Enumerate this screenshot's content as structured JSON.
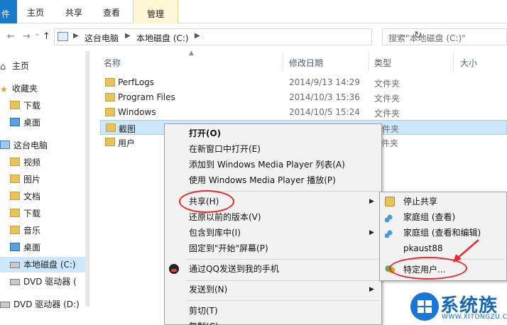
{
  "ribbon": {
    "tabs": [
      "件",
      "主页",
      "共享",
      "查看",
      "管理"
    ],
    "context_color": "#f3d24c"
  },
  "nav": {
    "back": "←",
    "forward": "→",
    "history": "⌄",
    "up": "↑",
    "breadcrumb": [
      "这台电脑",
      "本地磁盘 (C:)"
    ],
    "refresh": "↻",
    "search_placeholder": "搜索\"本地磁盘 (C:)\""
  },
  "sidebar": {
    "items": [
      {
        "label": "主页",
        "icon": "home-icon"
      },
      {
        "label": "收藏夹",
        "icon": "star-icon"
      },
      {
        "label": "下载",
        "icon": "download-folder-icon"
      },
      {
        "label": "桌面",
        "icon": "desktop-icon"
      },
      {
        "label": "这台电脑",
        "icon": "computer-icon"
      },
      {
        "label": "视频",
        "icon": "videos-folder-icon"
      },
      {
        "label": "图片",
        "icon": "pictures-folder-icon"
      },
      {
        "label": "文档",
        "icon": "documents-folder-icon"
      },
      {
        "label": "下载",
        "icon": "download-folder-icon"
      },
      {
        "label": "音乐",
        "icon": "music-folder-icon"
      },
      {
        "label": "桌面",
        "icon": "desktop-icon"
      },
      {
        "label": "本地磁盘 (C:)",
        "icon": "drive-icon"
      },
      {
        "label": "DVD 驱动器 (",
        "icon": "dvd-icon"
      },
      {
        "label": "DVD 驱动器 (D:)",
        "icon": "dvd-icon"
      }
    ]
  },
  "columns": {
    "name": "名称",
    "date": "修改日期",
    "type": "类型",
    "size": "大小"
  },
  "files": [
    {
      "name": "PerfLogs",
      "date": "2014/9/13 14:29",
      "type": "文件夹"
    },
    {
      "name": "Program Files",
      "date": "2014/10/3 15:36",
      "type": "文件夹"
    },
    {
      "name": "Windows",
      "date": "2014/10/5 15:24",
      "type": "文件夹"
    },
    {
      "name": "截图",
      "date": "",
      "type": "件夹"
    },
    {
      "name": "用户",
      "date": "",
      "type": "件夹"
    }
  ],
  "context_menu": {
    "items": [
      {
        "label": "打开(O)",
        "bold": true
      },
      {
        "label": "在新窗口中打开(E)"
      },
      {
        "label": "添加到 Windows Media Player 列表(A)"
      },
      {
        "label": "使用 Windows Media Player 播放(P)"
      },
      {
        "label": "共享(H)",
        "submenu": true
      },
      {
        "label": "还原以前的版本(V)"
      },
      {
        "label": "包含到库中(I)",
        "submenu": true
      },
      {
        "label": "固定到\"开始\"屏幕(P)"
      },
      {
        "label": "通过QQ发送到我的手机"
      },
      {
        "label": "发送到(N)",
        "submenu": true
      },
      {
        "label": "剪切(T)"
      },
      {
        "label": "复制(C)"
      }
    ]
  },
  "share_submenu": {
    "items": [
      {
        "label": "停止共享",
        "icon": "lock-icon"
      },
      {
        "label": "家庭组 (查看)",
        "icon": "homegroup-icon"
      },
      {
        "label": "家庭组 (查看和编辑)",
        "icon": "homegroup-icon"
      },
      {
        "label": "pkaust88",
        "icon": ""
      },
      {
        "label": "特定用户...",
        "icon": "people-icon"
      }
    ]
  },
  "watermark": {
    "brand": "系统族",
    "url": "WWW.XITONGZU.COM"
  },
  "annotation_color": "#e8292f"
}
